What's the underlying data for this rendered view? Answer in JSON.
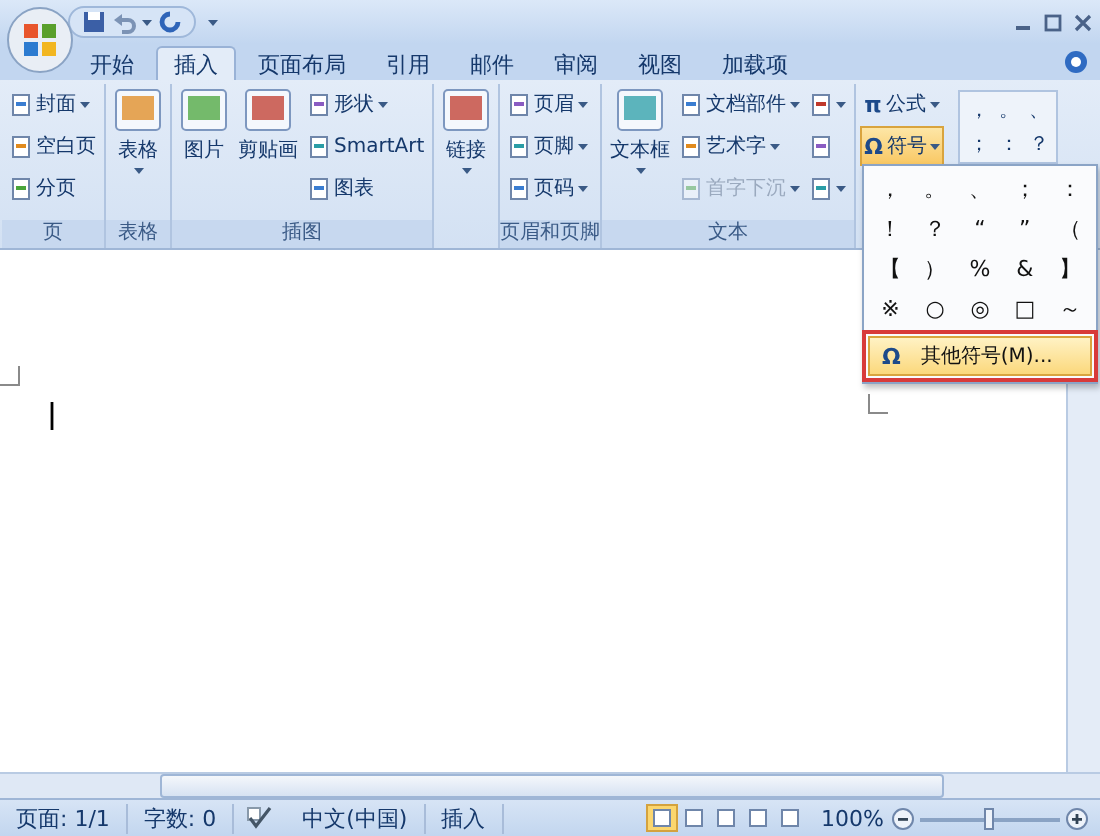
{
  "tabs": [
    {
      "label": "开始",
      "selected": false
    },
    {
      "label": "插入",
      "selected": true
    },
    {
      "label": "页面布局",
      "selected": false
    },
    {
      "label": "引用",
      "selected": false
    },
    {
      "label": "邮件",
      "selected": false
    },
    {
      "label": "审阅",
      "selected": false
    },
    {
      "label": "视图",
      "selected": false
    },
    {
      "label": "加载项",
      "selected": false
    }
  ],
  "ribbon": {
    "groups": [
      {
        "label": "页",
        "items": [
          {
            "kind": "small",
            "label": "封面",
            "menu": true,
            "disabled": false
          },
          {
            "kind": "small",
            "label": "空白页",
            "menu": false,
            "disabled": false
          },
          {
            "kind": "small",
            "label": "分页",
            "menu": false,
            "disabled": false
          }
        ]
      },
      {
        "label": "表格",
        "items": [
          {
            "kind": "large",
            "label": "表格",
            "menu": true,
            "disabled": false
          }
        ]
      },
      {
        "label": "插图",
        "items": [
          {
            "kind": "large",
            "label": "图片",
            "menu": false,
            "disabled": false
          },
          {
            "kind": "large",
            "label": "剪贴画",
            "menu": false,
            "disabled": false
          },
          {
            "kind": "small",
            "label": "形状",
            "menu": true,
            "disabled": false
          },
          {
            "kind": "small",
            "label": "SmartArt",
            "menu": false,
            "disabled": false
          },
          {
            "kind": "small",
            "label": "图表",
            "menu": false,
            "disabled": false
          }
        ]
      },
      {
        "items": [
          {
            "kind": "large",
            "label": "链接",
            "menu": true,
            "disabled": false
          }
        ]
      },
      {
        "label": "页眉和页脚",
        "items": [
          {
            "kind": "small",
            "label": "页眉",
            "menu": true,
            "disabled": false
          },
          {
            "kind": "small",
            "label": "页脚",
            "menu": true,
            "disabled": false
          },
          {
            "kind": "small",
            "label": "页码",
            "menu": true,
            "disabled": false
          }
        ]
      },
      {
        "label": "文本",
        "items": [
          {
            "kind": "large",
            "label": "文本框",
            "menu": true,
            "disabled": false
          },
          {
            "kind": "small",
            "label": "文档部件",
            "menu": true,
            "disabled": false
          },
          {
            "kind": "small",
            "label": "艺术字",
            "menu": true,
            "disabled": false
          },
          {
            "kind": "small",
            "label": "首字下沉",
            "menu": true,
            "disabled": true
          },
          {
            "kind": "icon",
            "menu": true,
            "disabled": false
          },
          {
            "kind": "icon",
            "menu": false,
            "disabled": false
          },
          {
            "kind": "icon",
            "menu": true,
            "disabled": false
          }
        ]
      },
      {
        "items": [
          {
            "kind": "symbol",
            "glyph": "π",
            "label": "公式",
            "menu": true,
            "selected": false
          },
          {
            "kind": "symbol",
            "glyph": "Ω",
            "label": "符号",
            "menu": true,
            "selected": true
          },
          {
            "kind": "gallery",
            "symbols": [
              "，",
              "。",
              "、",
              "；",
              "：",
              "？"
            ]
          }
        ]
      }
    ]
  },
  "symbol_menu": {
    "symbols": [
      "，",
      "。",
      "、",
      "；",
      "：",
      "！",
      "？",
      "“",
      "”",
      "（",
      "【",
      "）",
      "%",
      "&",
      "】",
      "※",
      "○",
      "◎",
      "□",
      "～"
    ],
    "more": {
      "glyph": "Ω",
      "label": "其他符号(M)...",
      "selected": true
    }
  },
  "status_bar": {
    "fields": [
      "页面: 1/1",
      "字数: 0"
    ],
    "language": "中文(中国)",
    "mode": "插入",
    "views": [
      {
        "selected": true
      },
      {
        "selected": false
      },
      {
        "selected": false
      },
      {
        "selected": false
      },
      {
        "selected": false
      }
    ],
    "zoom": {
      "label": "100%",
      "level": 0.5
    }
  }
}
